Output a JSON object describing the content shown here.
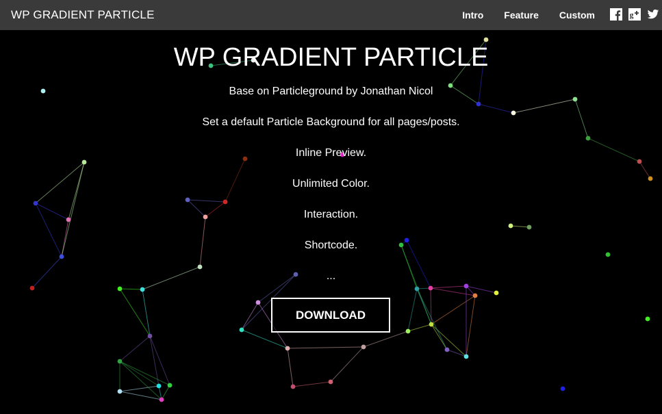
{
  "navbar": {
    "brand": "WP GRADIENT PARTICLE",
    "links": [
      "Intro",
      "Feature",
      "Custom"
    ],
    "social_icons": [
      "facebook-icon",
      "google-plus-icon",
      "twitter-icon"
    ]
  },
  "hero": {
    "title": "WP GRADIENT PARTICLE",
    "features": [
      "Base on Particleground by Jonathan Nicol",
      "Set a default Particle Background for all pages/posts.",
      "Inline Preview.",
      "Unlimited Color.",
      "Interaction.",
      "Shortcode.",
      "..."
    ],
    "download_label": "DOWNLOAD"
  },
  "colors": {
    "navbar_bg": "#3a3a3a",
    "page_bg": "#000000",
    "text": "#ffffff"
  }
}
